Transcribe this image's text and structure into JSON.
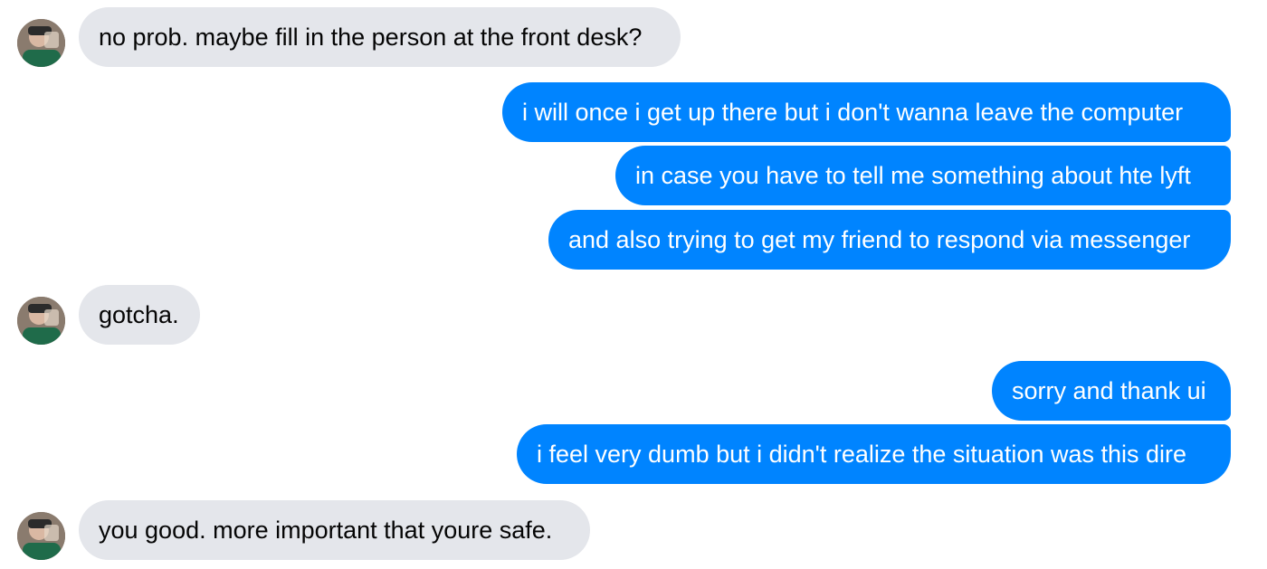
{
  "messages": [
    {
      "sender": "them",
      "text": "no prob. maybe fill in the person at the front desk?"
    },
    {
      "sender": "me",
      "text": "i will once i get up there but i don't wanna leave the computer"
    },
    {
      "sender": "me",
      "text": "in case you have to tell me something about hte lyft"
    },
    {
      "sender": "me",
      "text": "and also trying to get my friend to respond via messenger"
    },
    {
      "sender": "them",
      "text": "gotcha."
    },
    {
      "sender": "me",
      "text": "sorry and thank ui"
    },
    {
      "sender": "me",
      "text": "i feel very dumb but i didn't realize the situation was this dire"
    },
    {
      "sender": "them",
      "text": "you good. more important that youre safe."
    }
  ],
  "colors": {
    "incoming_bubble": "#e4e6eb",
    "outgoing_bubble": "#0084ff",
    "incoming_text": "#050505",
    "outgoing_text": "#ffffff"
  },
  "icons": {
    "avatar": "contact-avatar-photo"
  }
}
